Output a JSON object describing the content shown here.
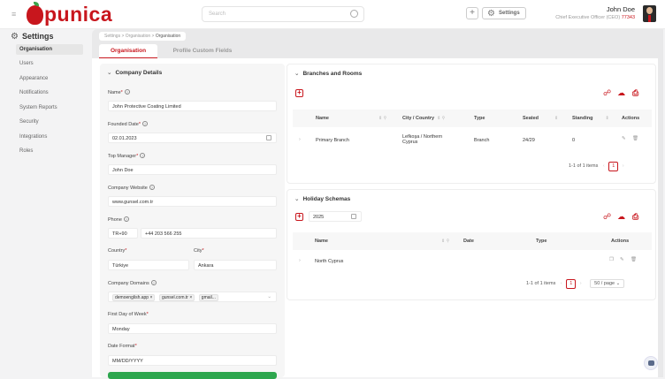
{
  "app": {
    "logo_text": "punica",
    "search_placeholder": "Search",
    "settings_label": "Settings"
  },
  "user": {
    "name": "John Doe",
    "role": "Chief Executive Officer (CEO)",
    "code": "77343"
  },
  "sidebar": {
    "title": "Settings",
    "items": [
      "Organisation",
      "Users",
      "Appearance",
      "Notifications",
      "System Reports",
      "Security",
      "Integrations",
      "Roles"
    ]
  },
  "breadcrumb": [
    "Settings",
    "Organisation",
    "Organisation"
  ],
  "tabs": [
    "Organisation",
    "Profile Custom Fields"
  ],
  "company": {
    "title": "Company Details",
    "name_label": "Name",
    "name": "John Protective Coating Limited",
    "founded_label": "Founded Date",
    "founded": "02.01.2023",
    "manager_label": "Top Manager",
    "manager": "John Doe",
    "website_label": "Company Website",
    "website": "www.gunsel.com.tr",
    "phone_label": "Phone",
    "phone_code": "TR+90",
    "phone": "+44 203 566 255",
    "country_label": "Country",
    "country": "Türkiye",
    "city_label": "City",
    "city": "Ankara",
    "domains_label": "Company Domains",
    "domains": [
      "demoenglish.app",
      "gunsel.com.tr",
      "gmail..."
    ],
    "firstday_label": "First Day of Week",
    "firstday": "Monday",
    "dateformat_label": "Date Format",
    "dateformat": "MM/DD/YYYY"
  },
  "branches": {
    "title": "Branches and Rooms",
    "columns": [
      "Name",
      "City / Country",
      "Type",
      "Seated",
      "Standing",
      "Actions"
    ],
    "rows": [
      {
        "name": "Primary Branch",
        "city": "Lefkoşa / Northern Cyprus",
        "type": "Branch",
        "seated": "24/29",
        "standing": "0"
      }
    ],
    "pagination": "1-1 of 1 items",
    "page": "1"
  },
  "holiday": {
    "title": "Holiday Schemas",
    "year": "2025",
    "columns": [
      "Name",
      "Date",
      "Type",
      "Actions"
    ],
    "rows": [
      {
        "name": "North Cyprus"
      }
    ],
    "pagination": "1-1 of 1 items",
    "page": "1",
    "page_size": "50 / page"
  }
}
